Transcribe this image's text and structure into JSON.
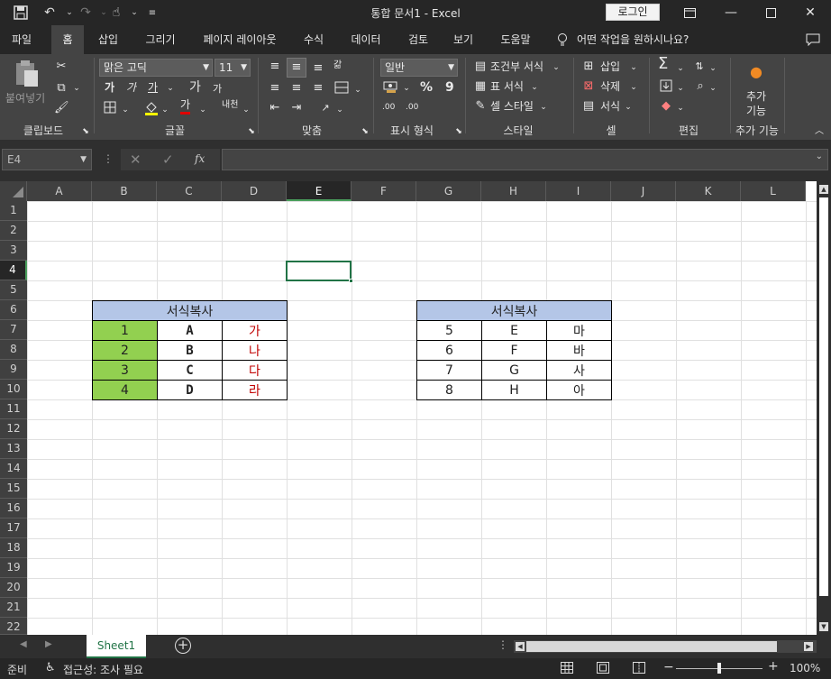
{
  "window": {
    "title": "통합 문서1  -  Excel",
    "login_label": "로그인"
  },
  "qat": {
    "save_icon": "save-icon",
    "undo_icon": "undo-icon",
    "redo_icon": "redo-icon",
    "touch_icon": "touch-mode-icon",
    "customize_icon": "customize-qat-icon"
  },
  "tabs": [
    "파일",
    "홈",
    "삽입",
    "그리기",
    "페이지 레이아웃",
    "수식",
    "데이터",
    "검토",
    "보기",
    "도움말"
  ],
  "active_tab": "홈",
  "tell_me": "어떤 작업을 원하시나요?",
  "ribbon": {
    "clipboard": {
      "paste_label": "붙여넣기",
      "group_label": "클립보드"
    },
    "font": {
      "font_name": "맑은 고딕",
      "font_size": "11",
      "group_label": "글꼴",
      "bold": "가",
      "italic": "가",
      "underline": "가",
      "grow": "가",
      "shrink": "가",
      "font_color_glyph": "가",
      "phonetic": "내천"
    },
    "alignment": {
      "group_label": "맞춤",
      "wrap_glyph": "갊"
    },
    "number": {
      "format": "일반",
      "group_label": "표시 형식",
      "percent": "%",
      "comma": "9",
      "inc_decimal": ".00",
      "dec_decimal": ".00"
    },
    "styles": {
      "conditional": "조건부 서식",
      "table": "표 서식",
      "cell_styles": "셀 스타일",
      "group_label": "스타일"
    },
    "cells": {
      "insert": "삽입",
      "delete": "삭제",
      "format": "서식",
      "group_label": "셀"
    },
    "editing": {
      "group_label": "편집",
      "sum_glyph": "Σ"
    },
    "addins": {
      "label1": "추가",
      "label2": "기능",
      "group_label": "추가 기능"
    }
  },
  "formula_bar": {
    "name_box": "E4",
    "fx": "fx"
  },
  "columns": [
    "A",
    "B",
    "C",
    "D",
    "E",
    "F",
    "G",
    "H",
    "I",
    "J",
    "K",
    "L"
  ],
  "selected_column": "E",
  "rows": [
    "1",
    "2",
    "3",
    "4",
    "5",
    "6",
    "7",
    "8",
    "9",
    "10",
    "11",
    "12",
    "13",
    "14",
    "15",
    "16",
    "17",
    "18",
    "19",
    "20",
    "21",
    "22"
  ],
  "selected_row": "4",
  "table1": {
    "header": "서식복사",
    "rows": [
      [
        "1",
        "A",
        "가"
      ],
      [
        "2",
        "B",
        "나"
      ],
      [
        "3",
        "C",
        "다"
      ],
      [
        "4",
        "D",
        "라"
      ]
    ]
  },
  "table2": {
    "header": "서식복사",
    "rows": [
      [
        "5",
        "E",
        "마"
      ],
      [
        "6",
        "F",
        "바"
      ],
      [
        "7",
        "G",
        "사"
      ],
      [
        "8",
        "H",
        "아"
      ]
    ]
  },
  "colors": {
    "header_fill": "#b4c6e7",
    "green_fill": "#92d050",
    "red_text": "#c00000",
    "selection_border": "#217346"
  },
  "sheets": [
    "Sheet1"
  ],
  "status": {
    "ready": "준비",
    "accessibility": "접근성: 조사 필요",
    "zoom": "100%"
  }
}
